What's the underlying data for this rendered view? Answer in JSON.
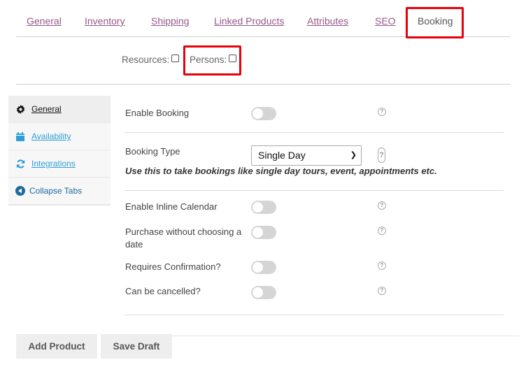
{
  "top_tabs": [
    {
      "label": "General",
      "active": false
    },
    {
      "label": "Inventory",
      "active": false
    },
    {
      "label": "Shipping",
      "active": false
    },
    {
      "label": "Linked Products",
      "active": false
    },
    {
      "label": "Attributes",
      "active": false
    },
    {
      "label": "SEO",
      "active": false
    },
    {
      "label": "Booking",
      "active": true
    }
  ],
  "options": {
    "resources_label": "Resources:",
    "resources_checked": false,
    "persons_label": "Persons:",
    "persons_checked": false
  },
  "sidebar": {
    "items": [
      {
        "label": "General",
        "icon": "gear-icon",
        "active": true
      },
      {
        "label": "Availability",
        "icon": "calendar-icon",
        "active": false
      },
      {
        "label": "Integrations",
        "icon": "sync-icon",
        "active": false
      },
      {
        "label": "Collapse Tabs",
        "icon": "collapse-arrow-icon",
        "active": false
      }
    ]
  },
  "form": {
    "enable_booking": {
      "label": "Enable Booking",
      "enabled": false
    },
    "booking_type": {
      "label": "Booking Type",
      "selected": "Single Day",
      "hint": "Use this to take bookings like single day tours, event, appointments etc."
    },
    "enable_inline_calendar": {
      "label": "Enable Inline Calendar",
      "enabled": false
    },
    "purchase_without_date": {
      "label": "Purchase without choosing a date",
      "enabled": false
    },
    "requires_confirmation": {
      "label": "Requires Confirmation?",
      "enabled": false
    },
    "can_be_cancelled": {
      "label": "Can be cancelled?",
      "enabled": false
    },
    "help_glyph": "?"
  },
  "footer": {
    "add_product_label": "Add Product",
    "save_draft_label": "Save Draft"
  },
  "colors": {
    "tab_link": "#96588a",
    "highlight": "#e8000d",
    "sidebar_link": "#2e9fd6"
  }
}
